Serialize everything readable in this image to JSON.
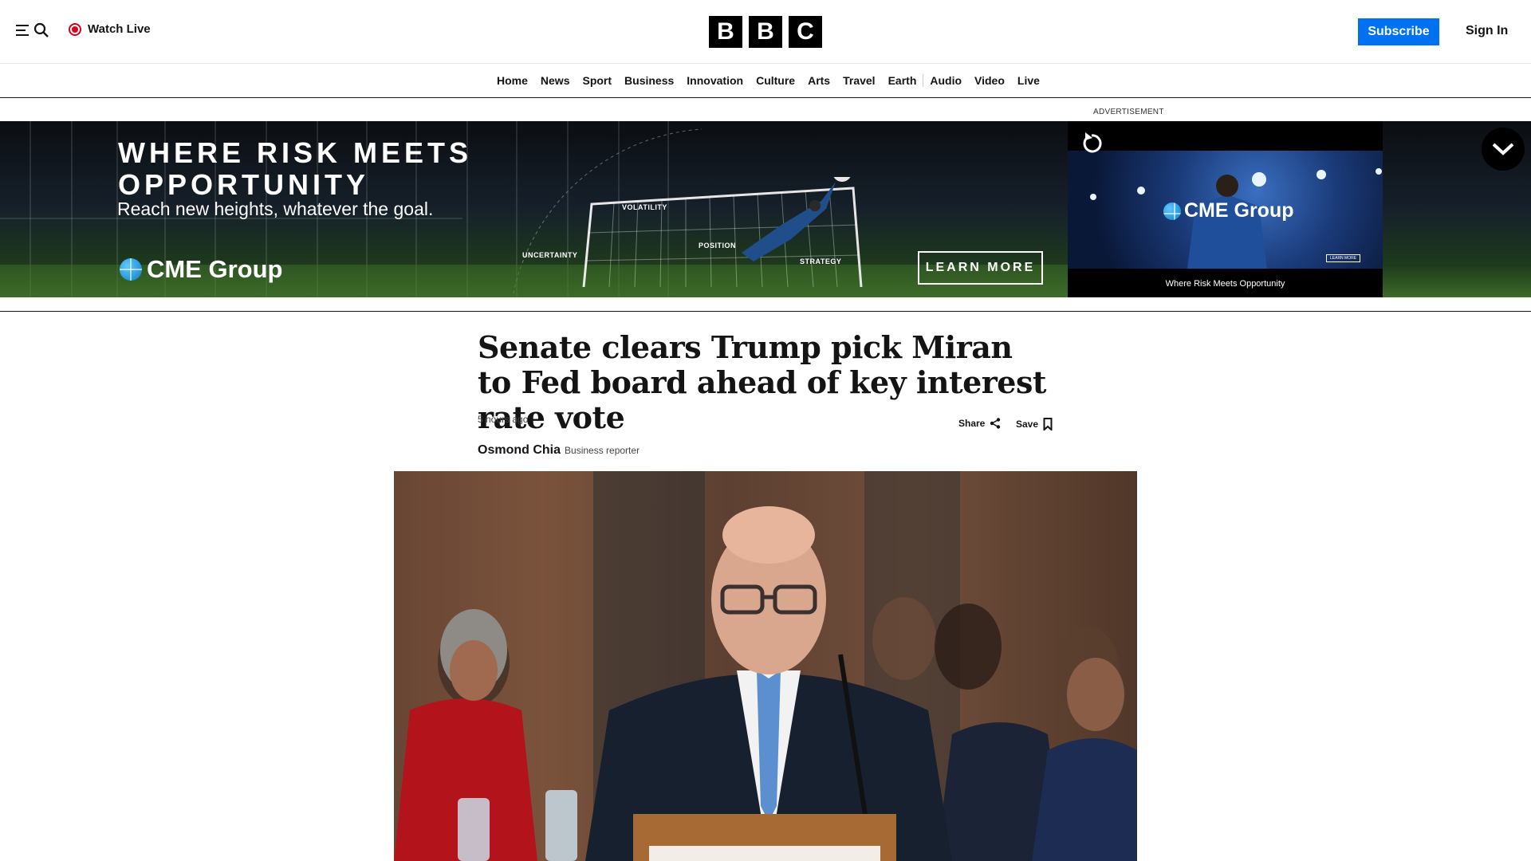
{
  "header": {
    "watch_live": "Watch Live",
    "logo_letters": [
      "B",
      "B",
      "C"
    ],
    "subscribe": "Subscribe",
    "sign_in": "Sign In"
  },
  "nav": {
    "items": [
      "Home",
      "News",
      "Sport",
      "Business",
      "Innovation",
      "Culture",
      "Arts",
      "Travel",
      "Earth",
      "Audio",
      "Video",
      "Live"
    ]
  },
  "ad": {
    "label": "ADVERTISEMENT",
    "headline_line1": "WHERE RISK MEETS",
    "headline_line2": "OPPORTUNITY",
    "subheadline": "Reach new heights, whatever the goal.",
    "brand": "CME Group",
    "tags": {
      "volatility": "VOLATILITY",
      "uncertainty": "UNCERTAINTY",
      "position": "POSITION",
      "strategy": "STRATEGY"
    },
    "cta": "LEARN MORE",
    "video_brand": "CME Group",
    "video_cta": "LEARN MORE",
    "video_caption": "Where Risk Meets Opportunity"
  },
  "article": {
    "headline": "Senate clears Trump pick Miran to Fed board ahead of key interest rate vote",
    "timestamp": "5 hours ago",
    "share_label": "Share",
    "save_label": "Save",
    "author": "Osmond Chia",
    "author_role": "Business reporter"
  },
  "icons": {
    "menu": "menu-icon",
    "search": "search-icon",
    "live": "live-dot-icon",
    "share": "share-icon",
    "save": "bookmark-icon",
    "replay": "replay-icon",
    "collapse": "chevron-down-icon"
  },
  "colors": {
    "subscribe_bg": "#0071f1",
    "live_red": "#d4001d",
    "logo_bg": "#000000"
  }
}
